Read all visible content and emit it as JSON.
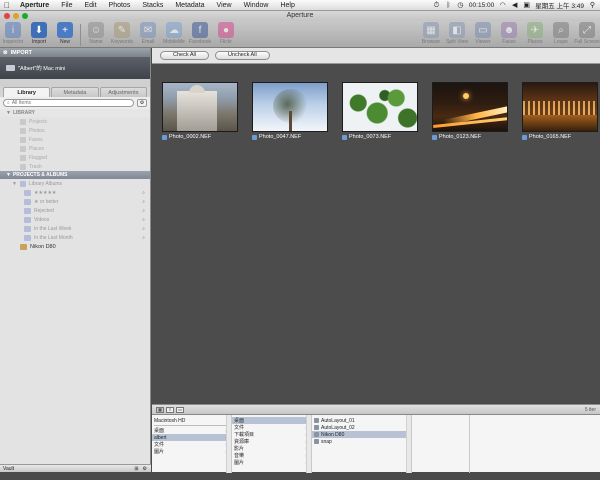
{
  "menubar": {
    "app_name": "Aperture",
    "items": [
      "File",
      "Edit",
      "Photos",
      "Stacks",
      "Metadata",
      "View",
      "Window",
      "Help"
    ],
    "timer": "00:15:00",
    "clock": "星期五 上午 3:49"
  },
  "window": {
    "title": "Aperture"
  },
  "toolbar": {
    "left": [
      {
        "label": "Inspector",
        "icon": "info-icon",
        "color": "#5a7fbf",
        "dim": true
      },
      {
        "label": "Import",
        "icon": "import-arrow-icon",
        "color": "#3f6fb6",
        "dim": false
      },
      {
        "label": "New",
        "icon": "new-plus-icon",
        "color": "#4a7bc3",
        "dim": false
      }
    ],
    "middle": [
      {
        "label": "Name",
        "icon": "person-icon",
        "color": "#8e8e8e",
        "dim": true
      },
      {
        "label": "Keywords",
        "icon": "tag-icon",
        "color": "#a59a78",
        "dim": true
      },
      {
        "label": "Email",
        "icon": "email-icon",
        "color": "#7a94bc",
        "dim": true
      },
      {
        "label": "MobileMe",
        "icon": "cloud-icon",
        "color": "#7ea2cf",
        "dim": true
      },
      {
        "label": "Facebook",
        "icon": "facebook-icon",
        "color": "#3b5998",
        "dim": true
      },
      {
        "label": "Flickr",
        "icon": "flickr-icon",
        "color": "#d34d8e",
        "dim": true
      }
    ],
    "right": [
      {
        "label": "Browser",
        "icon": "grid-icon",
        "color": "#8a98b3",
        "dim": true
      },
      {
        "label": "Split View",
        "icon": "split-view-icon",
        "color": "#8a98b3",
        "dim": true
      },
      {
        "label": "Viewer",
        "icon": "viewer-icon",
        "color": "#7d8fb0",
        "dim": true
      },
      {
        "label": "Faces",
        "icon": "faces-icon",
        "color": "#9a7fb0",
        "dim": true
      },
      {
        "label": "Places",
        "icon": "places-icon",
        "color": "#8ab07a",
        "dim": true
      },
      {
        "label": "Loupe",
        "icon": "loupe-icon",
        "color": "#7c7c7c",
        "dim": true
      },
      {
        "label": "Full Screen",
        "icon": "fullscreen-icon",
        "color": "#7c7c7c",
        "dim": true
      }
    ]
  },
  "sidebar": {
    "import_header": "IMPORT",
    "import_source": "\"Albert\"的 Mac mini",
    "tabs": [
      {
        "label": "Library",
        "active": true
      },
      {
        "label": "Metadata",
        "active": false
      },
      {
        "label": "Adjustments",
        "active": false
      }
    ],
    "search": {
      "placeholder": "All Items"
    },
    "library_header": "LIBRARY",
    "library_items": [
      "Projects",
      "Photos",
      "Faces",
      "Places",
      "Flagged",
      "Trash"
    ],
    "projects_header": "PROJECTS & ALBUMS",
    "albums_folder": "Library Albums",
    "album_items": [
      "★★★★★",
      "★ or better",
      "Rejected",
      "Videos",
      "In the Last Week",
      "In the Last Month"
    ],
    "project_item": "Nikon D80",
    "vault_label": "Vault"
  },
  "main": {
    "check_all": "Check All",
    "uncheck_all": "Uncheck All",
    "photos": [
      {
        "name": "Photo_0002.NEF",
        "style": "p1"
      },
      {
        "name": "Photo_0047.NEF",
        "style": "p2"
      },
      {
        "name": "Photo_0073.NEF",
        "style": "p3"
      },
      {
        "name": "Photo_0123.NEF",
        "style": "p4"
      },
      {
        "name": "Photo_0165.NEF",
        "style": "p5"
      }
    ],
    "photo_count": "5 iter"
  },
  "file_browser": {
    "col1": {
      "top": "Macintosh HD",
      "items": [
        "桌面",
        "albert",
        "文件",
        "圖片"
      ],
      "selected": 1
    },
    "col2": {
      "items": [
        "桌面",
        "文件",
        "下載項目",
        "資源庫",
        "影片",
        "音樂",
        "圖片"
      ],
      "selected": 0
    },
    "col3": {
      "items": [
        "AutoLayout_01",
        "AutoLayout_02",
        "Nikon D80",
        "snap"
      ],
      "selected": 2
    }
  }
}
